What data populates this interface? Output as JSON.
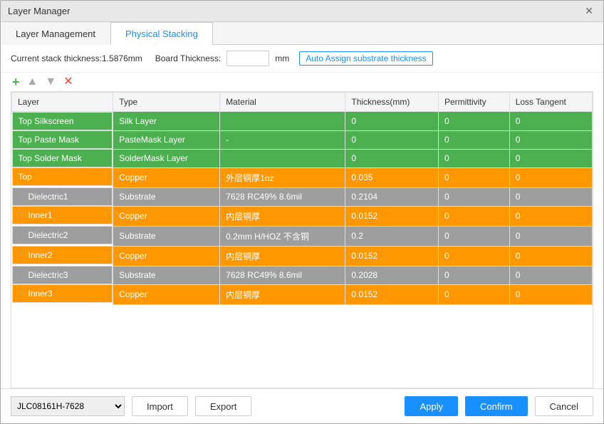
{
  "dialog": {
    "title": "Layer Manager",
    "close_label": "✕"
  },
  "tabs": [
    {
      "id": "layer-management",
      "label": "Layer Management",
      "active": false
    },
    {
      "id": "physical-stacking",
      "label": "Physical Stacking",
      "active": true
    }
  ],
  "toolbar": {
    "thickness_info": "Current stack thickness:1.5876mm",
    "board_thickness_label": "Board Thickness:",
    "board_thickness_value": "",
    "mm_label": "mm",
    "auto_assign_label": "Auto Assign substrate thickness",
    "add_icon": "+",
    "up_icon": "▲",
    "down_icon": "▼",
    "delete_icon": "✕"
  },
  "table": {
    "headers": [
      "Layer",
      "Type",
      "Material",
      "Thickness(mm)",
      "Permittivity",
      "Loss Tangent"
    ],
    "rows": [
      {
        "color": "green",
        "drag": false,
        "name": "Top Silkscreen",
        "type": "Silk Layer",
        "material": "",
        "thickness": "0",
        "permittivity": "0",
        "loss_tangent": "0"
      },
      {
        "color": "green",
        "drag": false,
        "name": "Top Paste Mask",
        "type": "PasteMask Layer",
        "material": "-",
        "thickness": "0",
        "permittivity": "0",
        "loss_tangent": "0"
      },
      {
        "color": "green",
        "drag": false,
        "name": "Top Solder Mask",
        "type": "SolderMask Layer",
        "material": "",
        "thickness": "0",
        "permittivity": "0",
        "loss_tangent": "0"
      },
      {
        "color": "orange",
        "drag": false,
        "name": "Top",
        "type": "Copper",
        "material": "外层铜厚1oz",
        "thickness": "0.035",
        "permittivity": "0",
        "loss_tangent": "0"
      },
      {
        "color": "gray",
        "drag": true,
        "name": "Dielectric1",
        "type": "Substrate",
        "material": "7628 RC49% 8.6mil",
        "thickness": "0.2104",
        "permittivity": "0",
        "loss_tangent": "0"
      },
      {
        "color": "orange",
        "drag": true,
        "name": "Inner1",
        "type": "Copper",
        "material": "内层铜厚",
        "thickness": "0.0152",
        "permittivity": "0",
        "loss_tangent": "0"
      },
      {
        "color": "gray",
        "drag": true,
        "name": "Dielectric2",
        "type": "Substrate",
        "material": "0.2mm H/HOZ 不含铜",
        "thickness": "0.2",
        "permittivity": "0",
        "loss_tangent": "0"
      },
      {
        "color": "orange",
        "drag": true,
        "name": "Inner2",
        "type": "Copper",
        "material": "内层铜厚",
        "thickness": "0.0152",
        "permittivity": "0",
        "loss_tangent": "0"
      },
      {
        "color": "gray",
        "drag": true,
        "name": "Dielectric3",
        "type": "Substrate",
        "material": "7628 RC49% 8.6mil",
        "thickness": "0.2028",
        "permittivity": "0",
        "loss_tangent": "0"
      },
      {
        "color": "orange",
        "drag": true,
        "name": "Inner3",
        "type": "Copper",
        "material": "内层铜厚",
        "thickness": "0.0152",
        "permittivity": "0",
        "loss_tangent": "0"
      }
    ]
  },
  "footer": {
    "preset_value": "JLC08161H-7628",
    "preset_options": [
      "JLC08161H-7628"
    ],
    "import_label": "Import",
    "export_label": "Export",
    "apply_label": "Apply",
    "confirm_label": "Confirm",
    "cancel_label": "Cancel"
  }
}
